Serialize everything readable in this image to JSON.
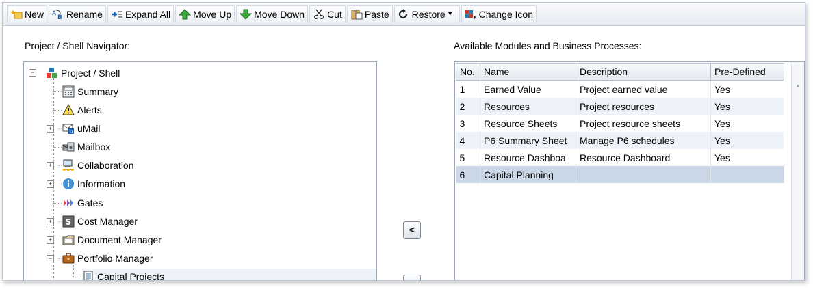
{
  "toolbar": {
    "new": "New",
    "rename": "Rename",
    "expand_all": "Expand All",
    "move_up": "Move Up",
    "move_down": "Move Down",
    "cut": "Cut",
    "paste": "Paste",
    "restore": "Restore",
    "change_icon": "Change Icon"
  },
  "left_label": "Project / Shell Navigator:",
  "right_label": "Available Modules and Business Processes:",
  "tree": {
    "root": "Project / Shell",
    "items": [
      {
        "label": "Summary",
        "icon": "calculator-icon"
      },
      {
        "label": "Alerts",
        "icon": "warning-icon"
      },
      {
        "label": "uMail",
        "icon": "mail-icon"
      },
      {
        "label": "Mailbox",
        "icon": "mailbox-icon"
      },
      {
        "label": "Collaboration",
        "icon": "network-icon"
      },
      {
        "label": "Information",
        "icon": "info-icon"
      },
      {
        "label": "Gates",
        "icon": "gates-icon"
      },
      {
        "label": "Cost Manager",
        "icon": "dollar-icon"
      },
      {
        "label": "Document Manager",
        "icon": "folder-icon"
      },
      {
        "label": "Portfolio Manager",
        "icon": "briefcase-icon"
      },
      {
        "label": "Capital Projects",
        "icon": "document-icon"
      }
    ]
  },
  "arrows": {
    "add": "<"
  },
  "grid": {
    "headers": [
      "No.",
      "Name",
      "Description",
      "Pre-Defined"
    ],
    "rows": [
      [
        "1",
        "Earned Value",
        "Project earned value",
        "Yes"
      ],
      [
        "2",
        "Resources",
        "Project resources",
        "Yes"
      ],
      [
        "3",
        "Resource Sheets",
        "Project resource sheets",
        "Yes"
      ],
      [
        "4",
        "P6 Summary Sheet",
        "Manage P6 schedules",
        "Yes"
      ],
      [
        "5",
        "Resource Dashboa",
        "Resource Dashboard",
        "Yes"
      ],
      [
        "6",
        "Capital Planning",
        "",
        ""
      ]
    ]
  }
}
